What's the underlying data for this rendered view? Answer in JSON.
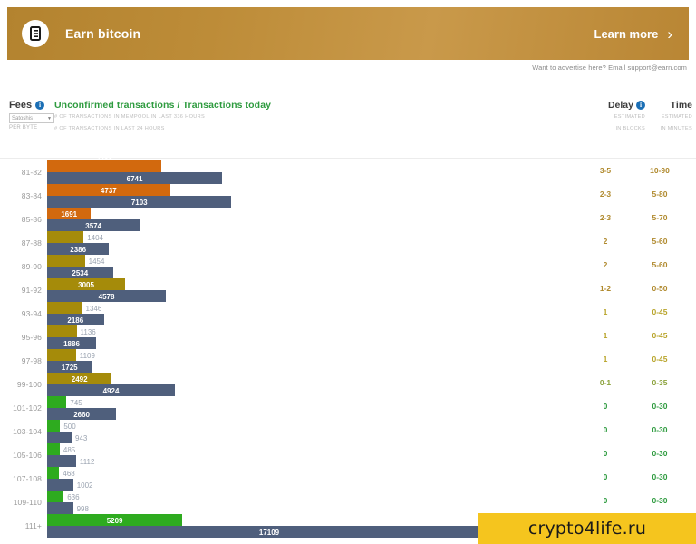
{
  "ad": {
    "logo_icon": "earn-logo-icon",
    "title": "Earn bitcoin",
    "cta_label": "Learn more",
    "chevron_icon": "chevron-right-icon",
    "note": "Want to advertise here? Email support@earn.com"
  },
  "header": {
    "fees": {
      "label": "Fees",
      "info_icon": "info-icon",
      "select_value": "Satoshis",
      "caret_icon": "chevron-down-icon",
      "unit": "PER BYTE"
    },
    "transactions": {
      "title_unconfirmed": "Unconfirmed transactions",
      "title_separator": " / ",
      "title_today": "Transactions today",
      "sub1": "# OF TRANSACTIONS IN MEMPOOL IN LAST 336 HOURS",
      "sub2": "# OF TRANSACTIONS IN LAST 24 HOURS"
    },
    "delay": {
      "label": "Delay",
      "info_icon": "info-icon",
      "sub1": "ESTIMATED",
      "sub2": "IN BLOCKS"
    },
    "time": {
      "label": "Time",
      "sub1": "ESTIMATED",
      "sub2": "IN MINUTES"
    }
  },
  "watermark": {
    "text": "crypto4life.ru"
  },
  "colors": {
    "orange": "#d2690e",
    "olive": "#a58b0a",
    "green": "#2eab1f",
    "bluegray": "#4f5f7c",
    "brand_green": "#2e9b3f",
    "banner_gold": "#bd8c38",
    "watermark_yellow": "#f5c51e"
  },
  "chart_data": {
    "type": "bar",
    "title": "Unconfirmed transactions / Transactions today",
    "xlabel": "",
    "ylabel": "Fees (satoshis per byte)",
    "orientation": "horizontal",
    "grid": false,
    "legend": [
      "Unconfirmed transactions (mempool, last 336 hours)",
      "Transactions today (last 24 hours)"
    ],
    "categories": [
      "81-82",
      "83-84",
      "85-86",
      "87-88",
      "89-90",
      "91-92",
      "93-94",
      "95-96",
      "97-98",
      "99-100",
      "101-102",
      "103-104",
      "105-106",
      "107-108",
      "109-110",
      "111+"
    ],
    "series": [
      {
        "name": "Unconfirmed transactions",
        "values": [
          4400,
          4737,
          1691,
          1404,
          1454,
          3005,
          1346,
          1136,
          1109,
          2492,
          745,
          500,
          485,
          468,
          636,
          5209
        ]
      },
      {
        "name": "Transactions today",
        "values": [
          6741,
          7103,
          3574,
          2386,
          2534,
          4578,
          2186,
          1886,
          1725,
          4924,
          2660,
          943,
          1112,
          1002,
          998,
          17109
        ]
      }
    ],
    "rows": [
      {
        "label": "81-82",
        "top_value": "4400",
        "top_value_clipped": true,
        "top_color": "#d2690e",
        "bot_value": "6741",
        "bot_color": "#4f5f7c",
        "delay": "3-5",
        "time": "10-90",
        "row_color": "#b08a2e"
      },
      {
        "label": "83-84",
        "top_value": "4737",
        "top_value_clipped": false,
        "top_color": "#d2690e",
        "bot_value": "7103",
        "bot_color": "#4f5f7c",
        "delay": "2-3",
        "time": "5-80",
        "row_color": "#b08a2e"
      },
      {
        "label": "85-86",
        "top_value": "1691",
        "top_value_clipped": false,
        "top_color": "#d2690e",
        "bot_value": "3574",
        "bot_color": "#4f5f7c",
        "delay": "2-3",
        "time": "5-70",
        "row_color": "#b08a2e"
      },
      {
        "label": "87-88",
        "top_value": "1404",
        "top_value_clipped": false,
        "top_color": "#a58b0a",
        "bot_value": "2386",
        "bot_color": "#4f5f7c",
        "delay": "2",
        "time": "5-60",
        "row_color": "#b08a2e"
      },
      {
        "label": "89-90",
        "top_value": "1454",
        "top_value_clipped": false,
        "top_color": "#a58b0a",
        "bot_value": "2534",
        "bot_color": "#4f5f7c",
        "delay": "2",
        "time": "5-60",
        "row_color": "#b08a2e"
      },
      {
        "label": "91-92",
        "top_value": "3005",
        "top_value_clipped": false,
        "top_color": "#a58b0a",
        "bot_value": "4578",
        "bot_color": "#4f5f7c",
        "delay": "1-2",
        "time": "0-50",
        "row_color": "#b08a2e"
      },
      {
        "label": "93-94",
        "top_value": "1346",
        "top_value_clipped": false,
        "top_color": "#a58b0a",
        "bot_value": "2186",
        "bot_color": "#4f5f7c",
        "delay": "1",
        "time": "0-45",
        "row_color": "#b8a42a"
      },
      {
        "label": "95-96",
        "top_value": "1136",
        "top_value_clipped": false,
        "top_color": "#a58b0a",
        "bot_value": "1886",
        "bot_color": "#4f5f7c",
        "delay": "1",
        "time": "0-45",
        "row_color": "#b8a42a"
      },
      {
        "label": "97-98",
        "top_value": "1109",
        "top_value_clipped": false,
        "top_color": "#a58b0a",
        "bot_value": "1725",
        "bot_color": "#4f5f7c",
        "delay": "1",
        "time": "0-45",
        "row_color": "#b8a42a"
      },
      {
        "label": "99-100",
        "top_value": "2492",
        "top_value_clipped": false,
        "top_color": "#a58b0a",
        "bot_value": "4924",
        "bot_color": "#4f5f7c",
        "delay": "0-1",
        "time": "0-35",
        "row_color": "#8aa13a"
      },
      {
        "label": "101-102",
        "top_value": "745",
        "top_value_clipped": false,
        "top_color": "#2eab1f",
        "bot_value": "2660",
        "bot_color": "#4f5f7c",
        "delay": "0",
        "time": "0-30",
        "row_color": "#2e9b3f"
      },
      {
        "label": "103-104",
        "top_value": "500",
        "top_value_clipped": false,
        "top_color": "#2eab1f",
        "bot_value": "943",
        "bot_color": "#4f5f7c",
        "delay": "0",
        "time": "0-30",
        "row_color": "#2e9b3f"
      },
      {
        "label": "105-106",
        "top_value": "485",
        "top_value_clipped": false,
        "top_color": "#2eab1f",
        "bot_value": "1112",
        "bot_color": "#4f5f7c",
        "delay": "0",
        "time": "0-30",
        "row_color": "#2e9b3f"
      },
      {
        "label": "107-108",
        "top_value": "468",
        "top_value_clipped": false,
        "top_color": "#2eab1f",
        "bot_value": "1002",
        "bot_color": "#4f5f7c",
        "delay": "0",
        "time": "0-30",
        "row_color": "#2e9b3f"
      },
      {
        "label": "109-110",
        "top_value": "636",
        "top_value_clipped": false,
        "top_color": "#2eab1f",
        "bot_value": "998",
        "bot_color": "#4f5f7c",
        "delay": "0",
        "time": "0-30",
        "row_color": "#2e9b3f"
      },
      {
        "label": "111+",
        "top_value": "5209",
        "top_value_clipped": false,
        "top_color": "#2eab1f",
        "bot_value": "17109",
        "bot_color": "#4f5f7c",
        "delay": "",
        "time": "",
        "row_color": "#2e9b3f"
      }
    ]
  }
}
